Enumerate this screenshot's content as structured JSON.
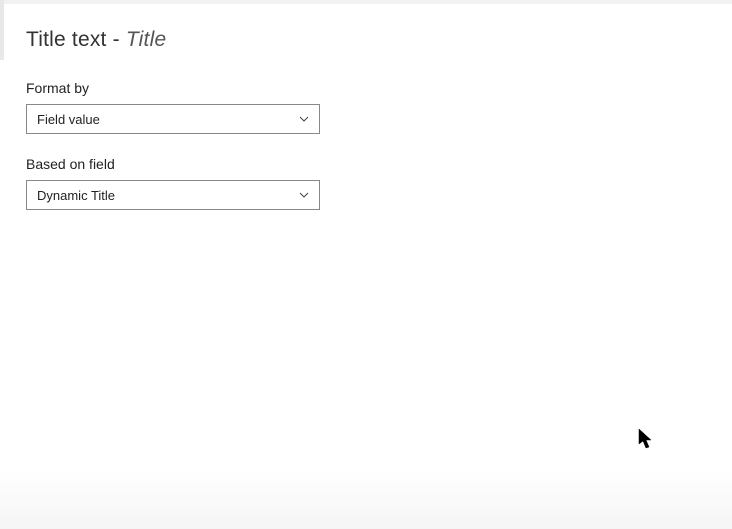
{
  "header": {
    "title": "Title text",
    "separator": " - ",
    "subtitle": "Title"
  },
  "fields": {
    "format_by": {
      "label": "Format by",
      "value": "Field value"
    },
    "based_on_field": {
      "label": "Based on field",
      "value": "Dynamic Title"
    }
  }
}
